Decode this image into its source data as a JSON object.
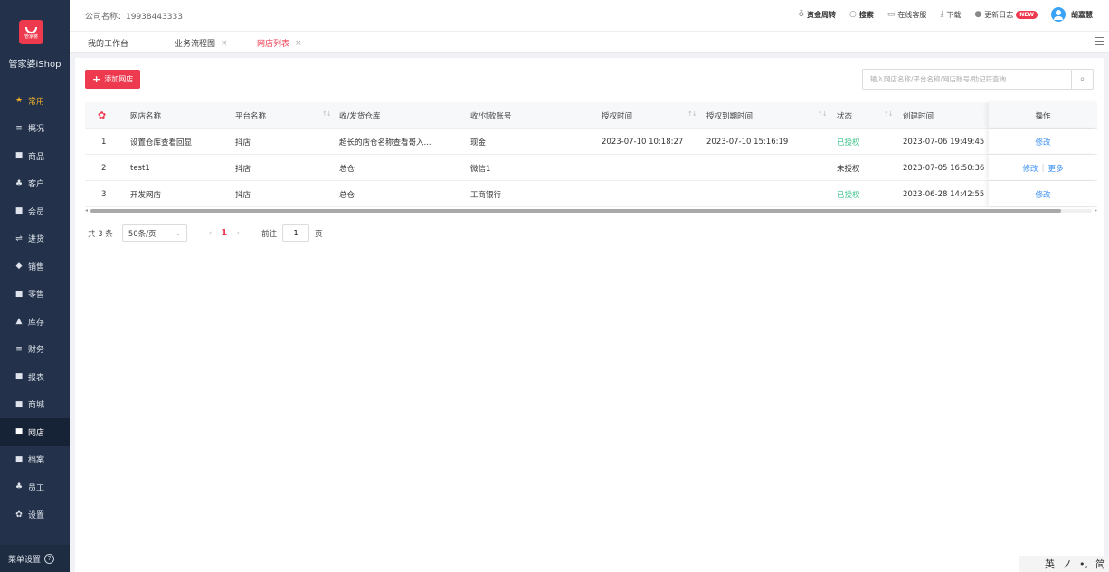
{
  "sidebar": {
    "logo_text": "管家婆",
    "brand": "管家婆iShop",
    "items": [
      {
        "icon": "★",
        "label": "常用",
        "state": "starred"
      },
      {
        "icon": "≡",
        "label": "概况",
        "state": ""
      },
      {
        "icon": "■",
        "label": "商品",
        "state": ""
      },
      {
        "icon": "♣",
        "label": "客户",
        "state": ""
      },
      {
        "icon": "■",
        "label": "会员",
        "state": ""
      },
      {
        "icon": "⇌",
        "label": "进货",
        "state": ""
      },
      {
        "icon": "◆",
        "label": "销售",
        "state": ""
      },
      {
        "icon": "■",
        "label": "零售",
        "state": ""
      },
      {
        "icon": "▲",
        "label": "库存",
        "state": ""
      },
      {
        "icon": "≡",
        "label": "财务",
        "state": ""
      },
      {
        "icon": "■",
        "label": "报表",
        "state": ""
      },
      {
        "icon": "■",
        "label": "商城",
        "state": ""
      },
      {
        "icon": "■",
        "label": "网店",
        "state": "active"
      },
      {
        "icon": "■",
        "label": "档案",
        "state": ""
      },
      {
        "icon": "♣",
        "label": "员工",
        "state": ""
      },
      {
        "icon": "✿",
        "label": "设置",
        "state": ""
      }
    ],
    "menu_settings": "菜单设置",
    "help": "?"
  },
  "header": {
    "company": "公司名称：19938443333",
    "toolbar": {
      "funds": "资金周转",
      "search": "搜索",
      "service": "在线客服",
      "download": "下载",
      "changelog": "更新日志",
      "new_badge": "NEW",
      "user": "胡嘉慧"
    }
  },
  "tabs": [
    {
      "label": "我的工作台",
      "closable": false
    },
    {
      "label": "业务流程图",
      "closable": true
    },
    {
      "label": "网店列表",
      "closable": true
    }
  ],
  "toolbar": {
    "add_label": "添加网店",
    "search_placeholder": "输入网店名称/平台名称/网店账号/助记符查询"
  },
  "table": {
    "columns": {
      "name": "网店名称",
      "platform": "平台名称",
      "warehouse": "收/发货仓库",
      "account": "收/付款账号",
      "auth_time": "授权时间",
      "expire_time": "授权到期时间",
      "status": "状态",
      "created": "创建时间",
      "op": "操作"
    },
    "rows": [
      {
        "idx": "1",
        "name": "设置仓库查看回显",
        "platform": "抖店",
        "warehouse": "超长的店仓名称查看哥入...",
        "account": "现金",
        "auth_time": "2023-07-10 10:18:27",
        "expire_time": "2023-07-10 15:16:19",
        "status": "已授权",
        "created": "2023-07-06 19:49:45",
        "op1": "修改",
        "op2": ""
      },
      {
        "idx": "2",
        "name": "test1",
        "platform": "抖店",
        "warehouse": "总仓",
        "account": "微信1",
        "auth_time": "",
        "expire_time": "",
        "status": "未授权",
        "created": "2023-07-05 16:50:36",
        "op1": "修改",
        "op2": "更多"
      },
      {
        "idx": "3",
        "name": "开发网店",
        "platform": "抖店",
        "warehouse": "总仓",
        "account": "工商银行",
        "auth_time": "",
        "expire_time": "",
        "status": "已授权",
        "created": "2023-06-28 14:42:55",
        "op1": "修改",
        "op2": ""
      }
    ]
  },
  "pager": {
    "total": "共 3 条",
    "page_size": "50条/页",
    "current_page": "1",
    "goto_label": "前往",
    "goto_value": "1",
    "page_suffix": "页"
  },
  "ime": {
    "a": "英",
    "b": "ノ",
    "c": "•,",
    "d": "简"
  },
  "colors": {
    "brand": "#ee3a4e",
    "sidebar": "#23324a",
    "link": "#3b8ff3",
    "status_ok": "#3cc38a"
  }
}
